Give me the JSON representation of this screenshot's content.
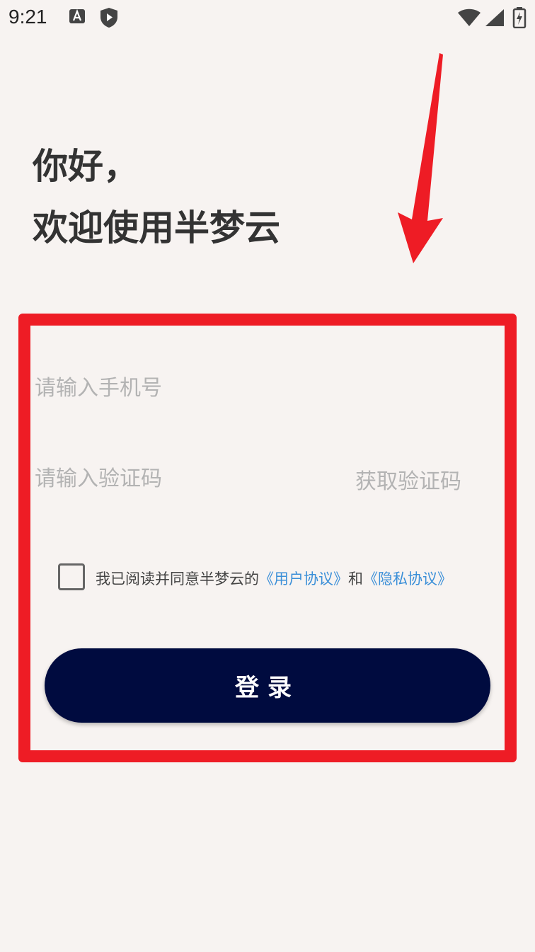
{
  "status_bar": {
    "time": "9:21"
  },
  "greeting": {
    "line1": "你好，",
    "line2": "欢迎使用半梦云"
  },
  "form": {
    "phone_placeholder": "请输入手机号",
    "code_placeholder": "请输入验证码",
    "get_code_label": "获取验证码",
    "agreement": {
      "prefix": "我已阅读并同意半梦云的",
      "user_agreement": "《用户协议》",
      "and": "和",
      "privacy_policy": "《隐私协议》"
    },
    "login_label": "登录"
  },
  "colors": {
    "accent": "#000b3f",
    "link": "#3b8fd8",
    "highlight": "#ee1c25",
    "background": "#f7f3f1"
  }
}
